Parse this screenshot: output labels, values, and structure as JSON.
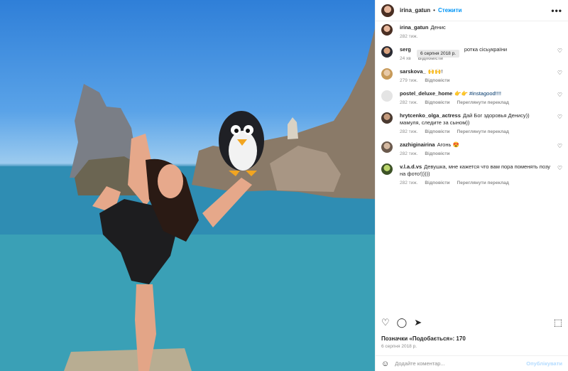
{
  "header": {
    "username": "irina_gatun",
    "dot": "•",
    "follow": "Стежити",
    "more": "•••"
  },
  "tooltip": "6 серпня 2018 р.",
  "comments": [
    {
      "user": "irina_gatun",
      "text": "Денис",
      "time": "282 тиж.",
      "reply": "",
      "translate": "",
      "heart": false
    },
    {
      "user": "serg",
      "text": "ротка сісьукраїни",
      "time": "24 хв",
      "reply": "Відповісти",
      "translate": "",
      "heart": true
    },
    {
      "user": "sarskova_",
      "text": "🙌🙌!",
      "time": "279 тиж.",
      "reply": "Відповісти",
      "translate": "",
      "heart": true
    },
    {
      "user": "postel_deluxe_home",
      "text": "👉👉 #instagood!!!!",
      "time": "282 тиж.",
      "reply": "Відповісти",
      "translate": "Переглянути переклад",
      "heart": true
    },
    {
      "user": "hrytcenko_olga_actress",
      "text": "Дай Бог здоровья Денису)) мамуля, следите за сыном))",
      "time": "282 тиж.",
      "reply": "Відповісти",
      "translate": "Переглянути переклад",
      "heart": true
    },
    {
      "user": "zazhiginairina",
      "text": "Агонь 😍",
      "time": "282 тиж.",
      "reply": "Відповісти",
      "translate": "",
      "heart": true
    },
    {
      "user": "v.l.a.d.vs",
      "text": "Девушка, мне кажется что вам пора поменять позу на фото!)))))",
      "time": "282 тиж.",
      "reply": "Відповісти",
      "translate": "Переглянути переклад",
      "heart": true
    }
  ],
  "actions": {
    "like": "♡",
    "comment": "◯",
    "share": "➤",
    "save": "⬚"
  },
  "likes": "Позначки «Подобається»: 170",
  "date": "6 серпня 2018 р.",
  "add_comment": {
    "emoji": "☺",
    "placeholder": "Додайте коментар...",
    "publish": "Опублікувати"
  }
}
